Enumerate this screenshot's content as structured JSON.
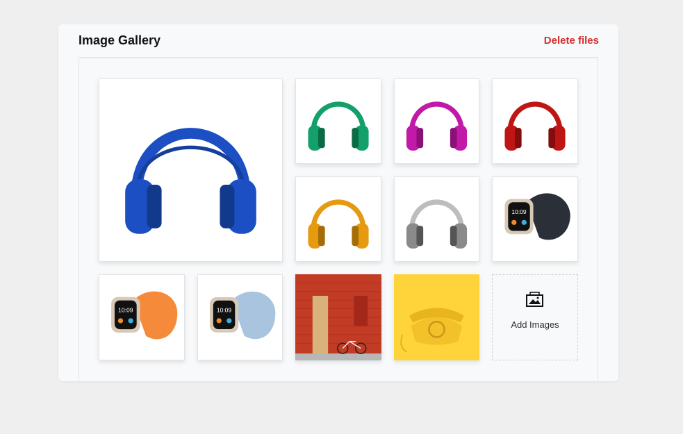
{
  "header": {
    "title": "Image Gallery",
    "delete_label": "Delete files"
  },
  "gallery": {
    "items": [
      {
        "name": "blue-headphones",
        "kind": "headphones",
        "color": "#1c4fc4"
      },
      {
        "name": "green-headphones",
        "kind": "headphones",
        "color": "#14a06a"
      },
      {
        "name": "magenta-headphones",
        "kind": "headphones",
        "color": "#c21aa8"
      },
      {
        "name": "red-headphones",
        "kind": "headphones",
        "color": "#c01515"
      },
      {
        "name": "orange-headphones",
        "kind": "headphones",
        "color": "#e69a10"
      },
      {
        "name": "silver-headphones",
        "kind": "headphones",
        "color": "#b8b8b8"
      },
      {
        "name": "black-band-watch",
        "kind": "watch",
        "color": "#2b2f38"
      },
      {
        "name": "orange-band-watch",
        "kind": "watch",
        "color": "#f58a3a"
      },
      {
        "name": "light-blue-band-watch",
        "kind": "watch",
        "color": "#a9c4de"
      },
      {
        "name": "red-brick-wall-photo",
        "kind": "photo",
        "color": "#c23b24"
      },
      {
        "name": "yellow-telephone-photo",
        "kind": "photo",
        "color": "#ffd43b"
      }
    ],
    "add_label": "Add Images",
    "add_icon": "image-add-icon"
  },
  "watch_face": {
    "time": "10:09"
  }
}
